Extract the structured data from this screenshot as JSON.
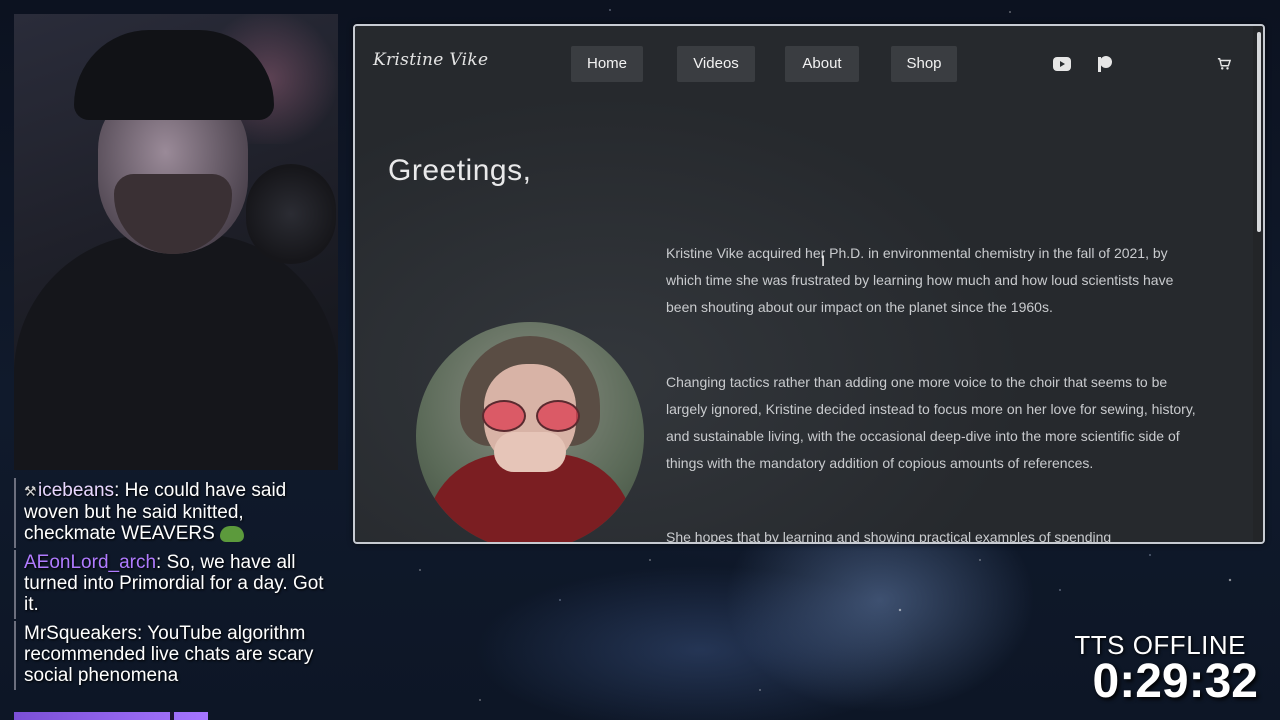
{
  "chat": {
    "messages": [
      {
        "user": "icebeans",
        "text": "He could have said woven but he said knitted, checkmate WEAVERS",
        "badge_icon": "pickaxe-badge-icon",
        "emote_icon": "pepe-emote-icon"
      },
      {
        "user": "AEonLord_arch",
        "text": "So, we have all turned into Primordial for a day. Got it."
      },
      {
        "user": "MrSqueakers",
        "text": "YouTube algorithm recommended live chats are scary social phenomena"
      }
    ]
  },
  "overlay": {
    "tts_status": "TTS OFFLINE",
    "timer": "0:29:32"
  },
  "site": {
    "brand": "Kristine Vike",
    "nav": {
      "home": "Home",
      "videos": "Videos",
      "about": "About",
      "shop": "Shop"
    },
    "social": {
      "youtube_icon": "youtube-icon",
      "patreon_icon": "patreon-icon",
      "cart_icon": "cart-icon"
    },
    "heading": "Greetings,",
    "paragraphs": [
      "Kristine Vike acquired her Ph.D. in environmental chemistry in the fall of 2021, by which time she was frustrated by learning how much and how loud scientists have been shouting about our impact on the planet since the 1960s.",
      "Changing tactics rather than adding one more voice to the choir that seems to be largely ignored, Kristine decided instead to focus more on her love for sewing, history, and sustainable living, with the occasional deep-dive into the more scientific side of things with the mandatory addition of copious amounts of references.",
      "She hopes that by learning and showing practical examples of spending"
    ]
  },
  "colors": {
    "accent_purple": "#a575ff",
    "chat_user_2": "#b07bff",
    "site_bg": "#2a2d31",
    "nav_button_bg": "#3a3d41"
  }
}
